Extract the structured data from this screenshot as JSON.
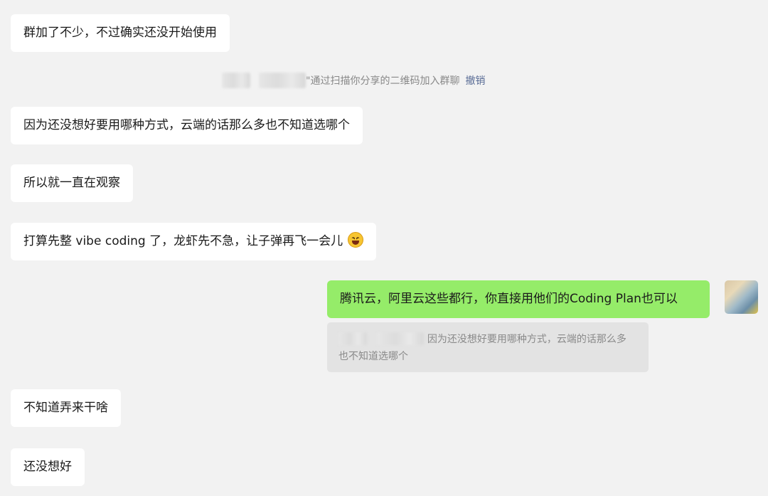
{
  "messages": [
    {
      "text": "群加了不少，不过确实还没开始使用"
    },
    {
      "text": "因为还没想好要用哪种方式，云端的话那么多也不知道选哪个"
    },
    {
      "text": "所以就一直在观察"
    },
    {
      "text": "打算先整 vibe coding 了，龙虾先不急，让子弹再飞一会儿"
    },
    {
      "text": "不知道弄来干啥"
    },
    {
      "text": "还没想好"
    }
  ],
  "system_notice": {
    "text": "\"通过扫描你分享的二维码加入群聊",
    "revoke_label": "撤销"
  },
  "outgoing": {
    "text": "腾讯云，阿里云这些都行，你直接用他们的Coding Plan也可以",
    "quote_line1": "因为还没想好要用哪种方式，云端的话那么多",
    "quote_line2": "也不知道选哪个"
  },
  "icons": {
    "emoji": "grinning-squinting-face-icon",
    "avatar": "user-avatar-photo"
  },
  "colors": {
    "background": "#f2f2f2",
    "incoming_bubble": "#ffffff",
    "outgoing_bubble": "#95ec69",
    "quote_background": "#e3e3e3",
    "link": "#586b95"
  }
}
